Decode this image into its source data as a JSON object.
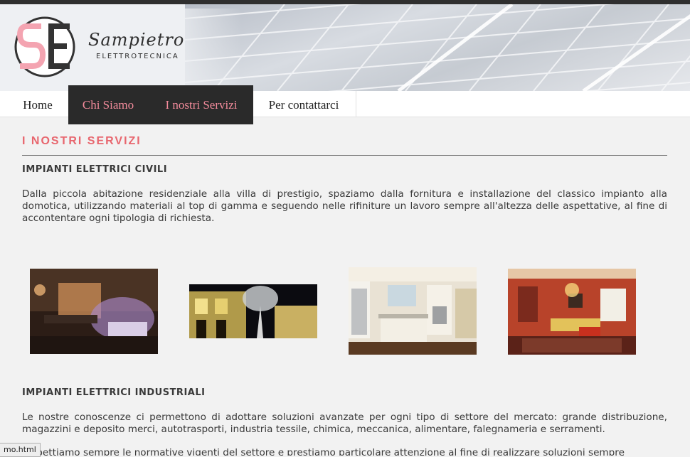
{
  "brand": {
    "name": "Sampietro",
    "subtitle": "ELETTROTECNICA"
  },
  "nav": {
    "items": [
      {
        "label": "Home",
        "active": false
      },
      {
        "label": "Chi Siamo",
        "active": true
      },
      {
        "label": "I nostri Servizi",
        "active": true
      },
      {
        "label": "Per contattarci",
        "active": false
      }
    ]
  },
  "main": {
    "title": "I NOSTRI SERVIZI",
    "sections": [
      {
        "heading": "IMPIANTI ELETTRICI CIVILI",
        "text": "Dalla piccola abitazione residenziale alla villa di prestigio, spaziamo dalla fornitura e installazione del classico impianto alla domotica, utilizzando materiali al top di gamma e seguendo nelle rifiniture un lavoro sempre all'altezza delle aspettative, al fine di accontentare ogni tipologia di richiesta."
      },
      {
        "heading": "IMPIANTI ELETTRICI INDUSTRIALI",
        "text": "Le nostre conoscenze ci permettono di adottare soluzioni avanzate per ogni tipo di settore del mercato: grande distribuzione, magazzini e deposito merci, autotrasporti, industria tessile, chimica, meccanica, alimentare, falegnameria e serramenti.",
        "text2": "Rispettiamo sempre le normative vigenti del settore e prestiamo particolare attenzione al fine di realizzare soluzioni sempre"
      }
    ],
    "gallery": [
      {
        "name": "lounge-room-photo"
      },
      {
        "name": "night-building-photo"
      },
      {
        "name": "kitchen-photo"
      },
      {
        "name": "dining-room-photo"
      }
    ]
  },
  "status": {
    "url": "mo.html"
  },
  "colors": {
    "accent": "#e8666e",
    "nav_active": "#f28b9b",
    "nav_dark": "#2a2a2a"
  }
}
